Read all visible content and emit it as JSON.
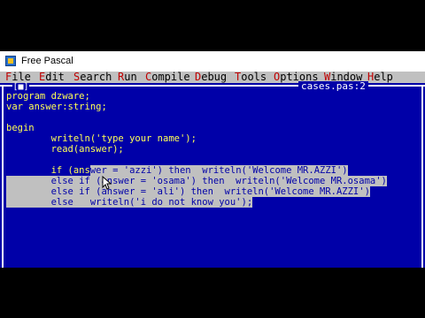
{
  "window": {
    "title": "Free Pascal",
    "icon": "free-pascal-icon"
  },
  "menu": [
    {
      "hot": "F",
      "rest": "ile"
    },
    {
      "hot": "E",
      "rest": "dit"
    },
    {
      "hot": "S",
      "rest": "earch"
    },
    {
      "hot": "R",
      "rest": "un"
    },
    {
      "hot": "C",
      "rest": "ompile"
    },
    {
      "hot": "D",
      "rest": "ebug"
    },
    {
      "hot": "T",
      "rest": "ools"
    },
    {
      "hot": "O",
      "rest": "ptions"
    },
    {
      "hot": "W",
      "rest": "indow"
    },
    {
      "hot": "H",
      "rest": "elp"
    }
  ],
  "editor": {
    "file_title": "cases.pas:2",
    "close_box": "[■]",
    "lines": [
      "program dzware;",
      "var answer:string;",
      "",
      "begin",
      "        writeln('type your name');",
      "        read(answer);",
      "",
      "        if (answer = 'azzi') then  writeln('Welcome MR.AZZI')",
      "        else if (answer = 'osama') then  writeln('Welcome MR.osama')",
      "        else if (answer = 'ali') then  writeln('Welcome MR.AZZI')",
      "        else   writeln('i do not know you');"
    ]
  },
  "colors": {
    "editor_bg": "#0000a8",
    "code_text": "#ffff55",
    "selection_bg": "#c0c0c0",
    "menubar_bg": "#c0c0c0",
    "menu_hotkey": "#c00000"
  }
}
